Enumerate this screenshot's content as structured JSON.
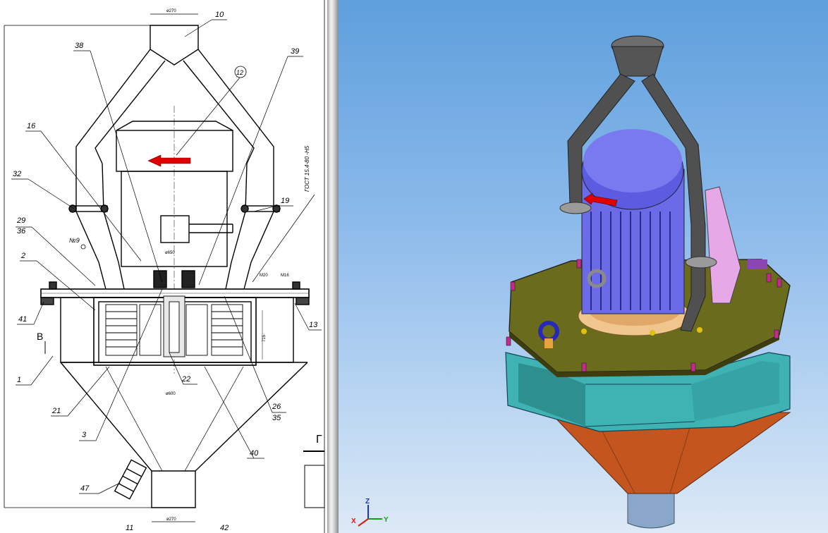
{
  "drawing": {
    "callouts": [
      "10",
      "38",
      "39",
      "12",
      "16",
      "32",
      "19",
      "29",
      "36",
      "2",
      "41",
      "1",
      "21",
      "3",
      "47",
      "11",
      "42",
      "22",
      "26",
      "35",
      "40",
      "13"
    ],
    "section_marker": "В",
    "position_marker": "№9",
    "dims": {
      "top": "ø270",
      "mid": "ø650",
      "bottom": "ø600",
      "foot": "ø270",
      "m20": "M20",
      "m16": "M16",
      "height": "715"
    },
    "gost_note": "ГОСТ 15.4-80 -Н5",
    "edge_fragment": "Г"
  },
  "viewport": {
    "axes": {
      "x": "X",
      "y": "Y",
      "z": "Z"
    },
    "colors": {
      "background_top": "#5e9fdc",
      "motor": "#6b6be8",
      "plate": "#6b6b1e",
      "housing": "#3fb3b3",
      "cone": "#c4551e",
      "pipe": "#505050"
    }
  }
}
